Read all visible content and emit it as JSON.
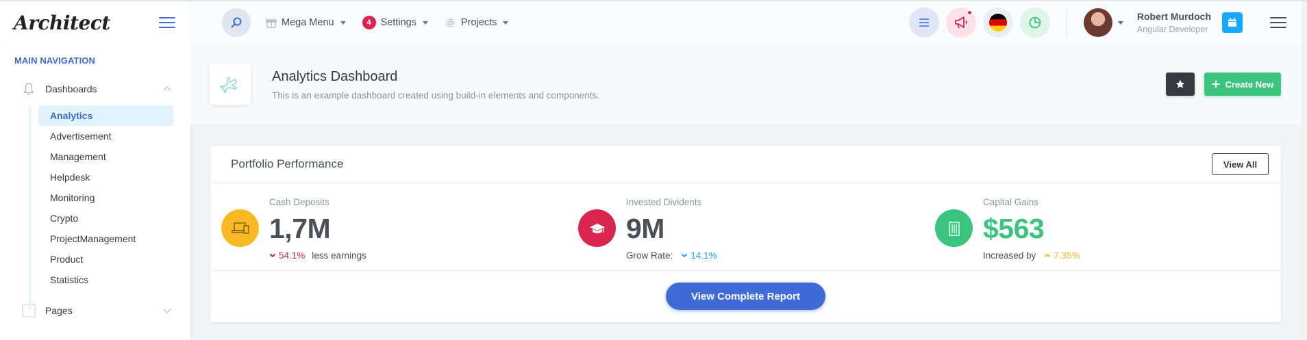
{
  "app": {
    "logo": "Architect"
  },
  "header": {
    "nav": [
      {
        "label": "Mega Menu",
        "icon": "gift-icon"
      },
      {
        "label": "Settings",
        "badge": "4"
      },
      {
        "label": "Projects",
        "icon": "gear-icon"
      }
    ],
    "user": {
      "name": "Robert Murdoch",
      "role": "Angular Developer"
    }
  },
  "sidebar": {
    "heading": "MAIN NAVIGATION",
    "dashboards_label": "Dashboards",
    "items": [
      "Analytics",
      "Advertisement",
      "Management",
      "Helpdesk",
      "Monitoring",
      "Crypto",
      "ProjectManagement",
      "Product",
      "Statistics"
    ],
    "pages_label": "Pages"
  },
  "page": {
    "title": "Analytics Dashboard",
    "subtitle": "This is an example dashboard created using build-in elements and components.",
    "create_label": "Create New"
  },
  "card": {
    "title": "Portfolio Performance",
    "view_all": "View All",
    "stats": [
      {
        "label": "Cash Deposits",
        "value": "1,7M",
        "pct": "54.1%",
        "trend": "down",
        "suffix": "less earnings",
        "color": "#f7b924",
        "value_color": "#495057",
        "pct_color": "#d92550"
      },
      {
        "label": "Invested Dividents",
        "value": "9M",
        "prefix": "Grow Rate:",
        "pct": "14.1%",
        "trend": "down",
        "color": "#d92550",
        "value_color": "#495057",
        "pct_color": "#16aaff"
      },
      {
        "label": "Capital Gains",
        "value": "$563",
        "prefix": "Increased by",
        "pct": "7.35%",
        "trend": "up",
        "color": "#3ac47d",
        "value_color": "#3ac47d",
        "pct_color": "#f7b924"
      }
    ],
    "report_button": "View Complete Report"
  },
  "colors": {
    "primary": "#3f6ad8",
    "success": "#3ac47d",
    "danger": "#d92550",
    "warning": "#f7b924",
    "info": "#16aaff"
  }
}
